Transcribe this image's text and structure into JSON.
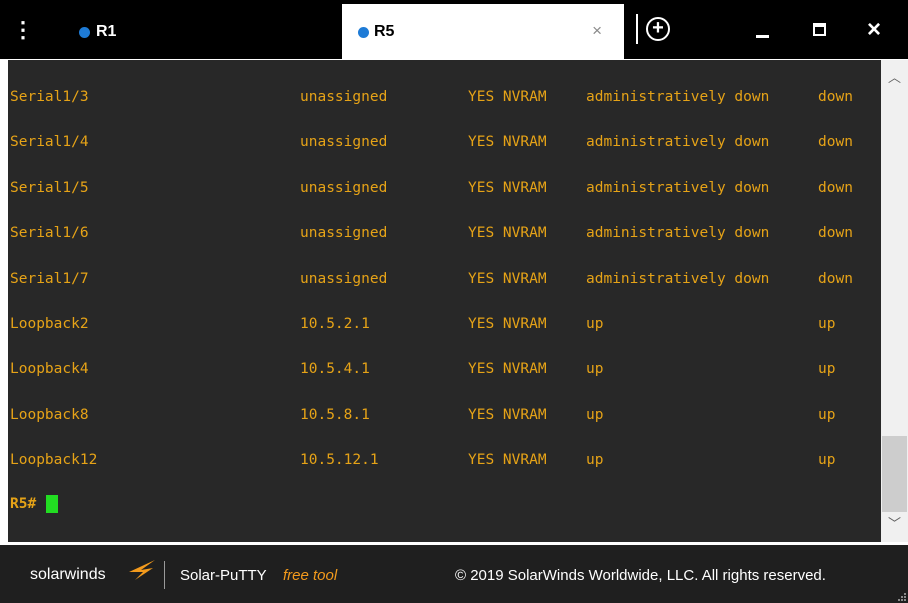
{
  "tabs": [
    {
      "label": "R1",
      "active": false
    },
    {
      "label": "R5",
      "active": true
    }
  ],
  "tab_close_glyph": "×",
  "new_tab_glyph": "+",
  "window_close_glyph": "×",
  "terminal": {
    "rows": [
      {
        "iface": "Serial1/3",
        "ip": "unassigned",
        "ok": "YES NVRAM",
        "status": "administratively down",
        "protocol": "down"
      },
      {
        "iface": "Serial1/4",
        "ip": "unassigned",
        "ok": "YES NVRAM",
        "status": "administratively down",
        "protocol": "down"
      },
      {
        "iface": "Serial1/5",
        "ip": "unassigned",
        "ok": "YES NVRAM",
        "status": "administratively down",
        "protocol": "down"
      },
      {
        "iface": "Serial1/6",
        "ip": "unassigned",
        "ok": "YES NVRAM",
        "status": "administratively down",
        "protocol": "down"
      },
      {
        "iface": "Serial1/7",
        "ip": "unassigned",
        "ok": "YES NVRAM",
        "status": "administratively down",
        "protocol": "down"
      },
      {
        "iface": "Loopback2",
        "ip": "10.5.2.1",
        "ok": "YES NVRAM",
        "status": "up",
        "protocol": "up"
      },
      {
        "iface": "Loopback4",
        "ip": "10.5.4.1",
        "ok": "YES NVRAM",
        "status": "up",
        "protocol": "up"
      },
      {
        "iface": "Loopback8",
        "ip": "10.5.8.1",
        "ok": "YES NVRAM",
        "status": "up",
        "protocol": "up"
      },
      {
        "iface": "Loopback12",
        "ip": "10.5.12.1",
        "ok": "YES NVRAM",
        "status": "up",
        "protocol": "up"
      }
    ],
    "prompt": "R5#"
  },
  "footer": {
    "logo_text": "solarwinds",
    "product": "Solar-PuTTY",
    "free_tag": "free tool",
    "copyright": "© 2019 SolarWinds Worldwide, LLC. All rights reserved."
  },
  "colors": {
    "terminal_bg": "#282828",
    "terminal_text": "#e6a317",
    "cursor": "#22dd22",
    "tab_dot": "#1e7bd6",
    "free_tag": "#f39a1c"
  }
}
